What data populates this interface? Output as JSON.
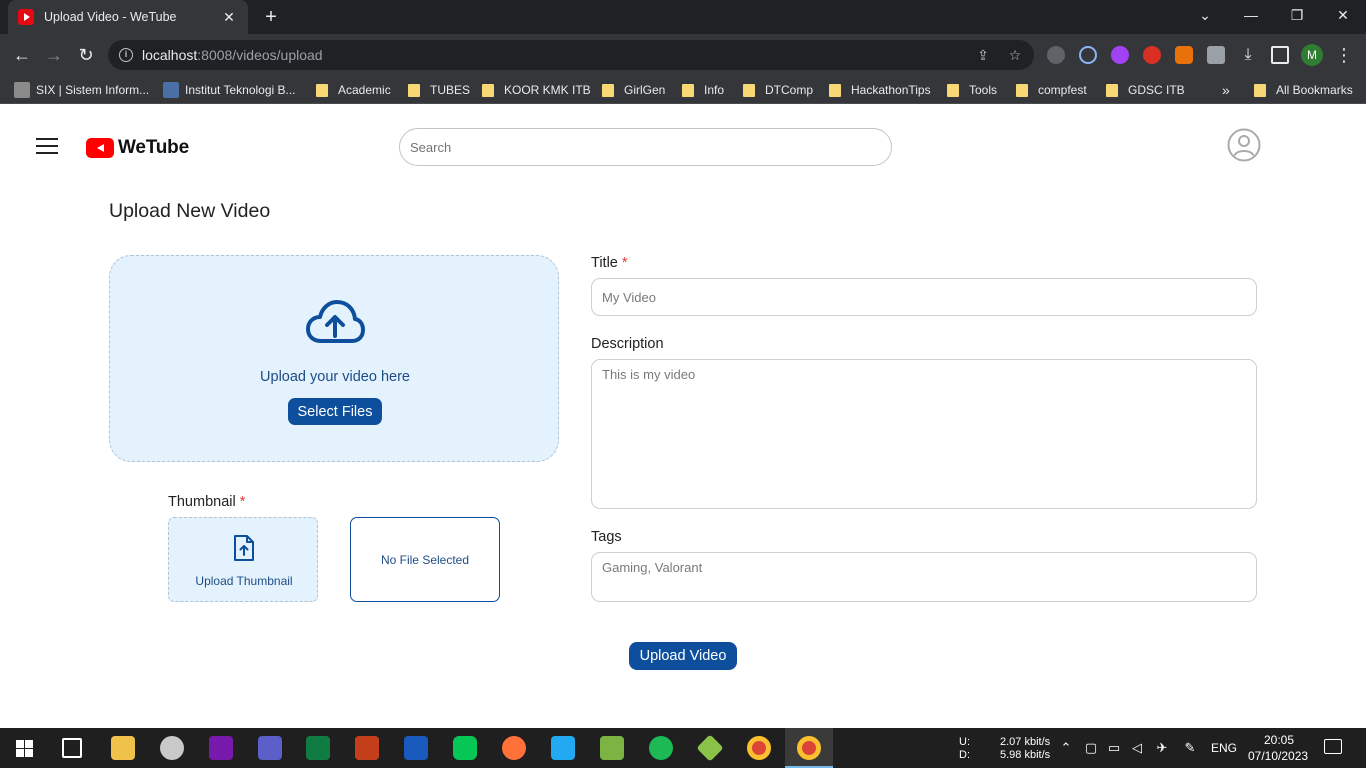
{
  "browser": {
    "tab_title": "Upload Video - WeTube",
    "new_tab_glyph": "+",
    "tab_close_glyph": "✕",
    "url_host": "localhost",
    "url_rest": ":8008/videos/upload",
    "profile_initial": "M",
    "window_controls": {
      "dropdown": "⌄",
      "minimize": "—",
      "restore": "❐",
      "close": "✕"
    },
    "bookmarks": [
      {
        "label": "SIX | Sistem Inform...",
        "kind": "site"
      },
      {
        "label": "Institut Teknologi B...",
        "kind": "site"
      },
      {
        "label": "Academic",
        "kind": "folder"
      },
      {
        "label": "TUBES",
        "kind": "folder"
      },
      {
        "label": "KOOR KMK ITB",
        "kind": "folder"
      },
      {
        "label": "GirlGen",
        "kind": "folder"
      },
      {
        "label": "Info",
        "kind": "folder"
      },
      {
        "label": "DTComp",
        "kind": "folder"
      },
      {
        "label": "HackathonTips",
        "kind": "folder"
      },
      {
        "label": "Tools",
        "kind": "folder"
      },
      {
        "label": "compfest",
        "kind": "folder"
      },
      {
        "label": "GDSC ITB",
        "kind": "folder"
      }
    ],
    "bookmarks_overflow": "»",
    "all_bookmarks": "All Bookmarks"
  },
  "app": {
    "brand": "WeTube",
    "search_placeholder": "Search"
  },
  "upload": {
    "page_title": "Upload New Video",
    "dropzone_text": "Upload your video here",
    "select_files_label": "Select Files",
    "thumbnail_label": "Thumbnail",
    "required_mark": "*",
    "upload_thumbnail_label": "Upload Thumbnail",
    "no_file_text": "No File Selected",
    "title_label": "Title",
    "title_placeholder": "My Video",
    "description_label": "Description",
    "description_placeholder": "This is my video",
    "tags_label": "Tags",
    "tags_placeholder": "Gaming, Valorant",
    "submit_label": "Upload Video"
  },
  "taskbar": {
    "net_up_label": "U:",
    "net_down_label": "D:",
    "net_up": "2.07 kbit/s",
    "net_down": "5.98 kbit/s",
    "language": "ENG",
    "time": "20:05",
    "date": "07/10/2023",
    "colors": {
      "accent": "#76b9ed",
      "background": "#1f1f1f"
    }
  },
  "colors": {
    "primary": "#0d4f9c",
    "dropzone_bg": "#e3f2fd",
    "required": "#e53935",
    "brand_red": "#ff0000"
  }
}
